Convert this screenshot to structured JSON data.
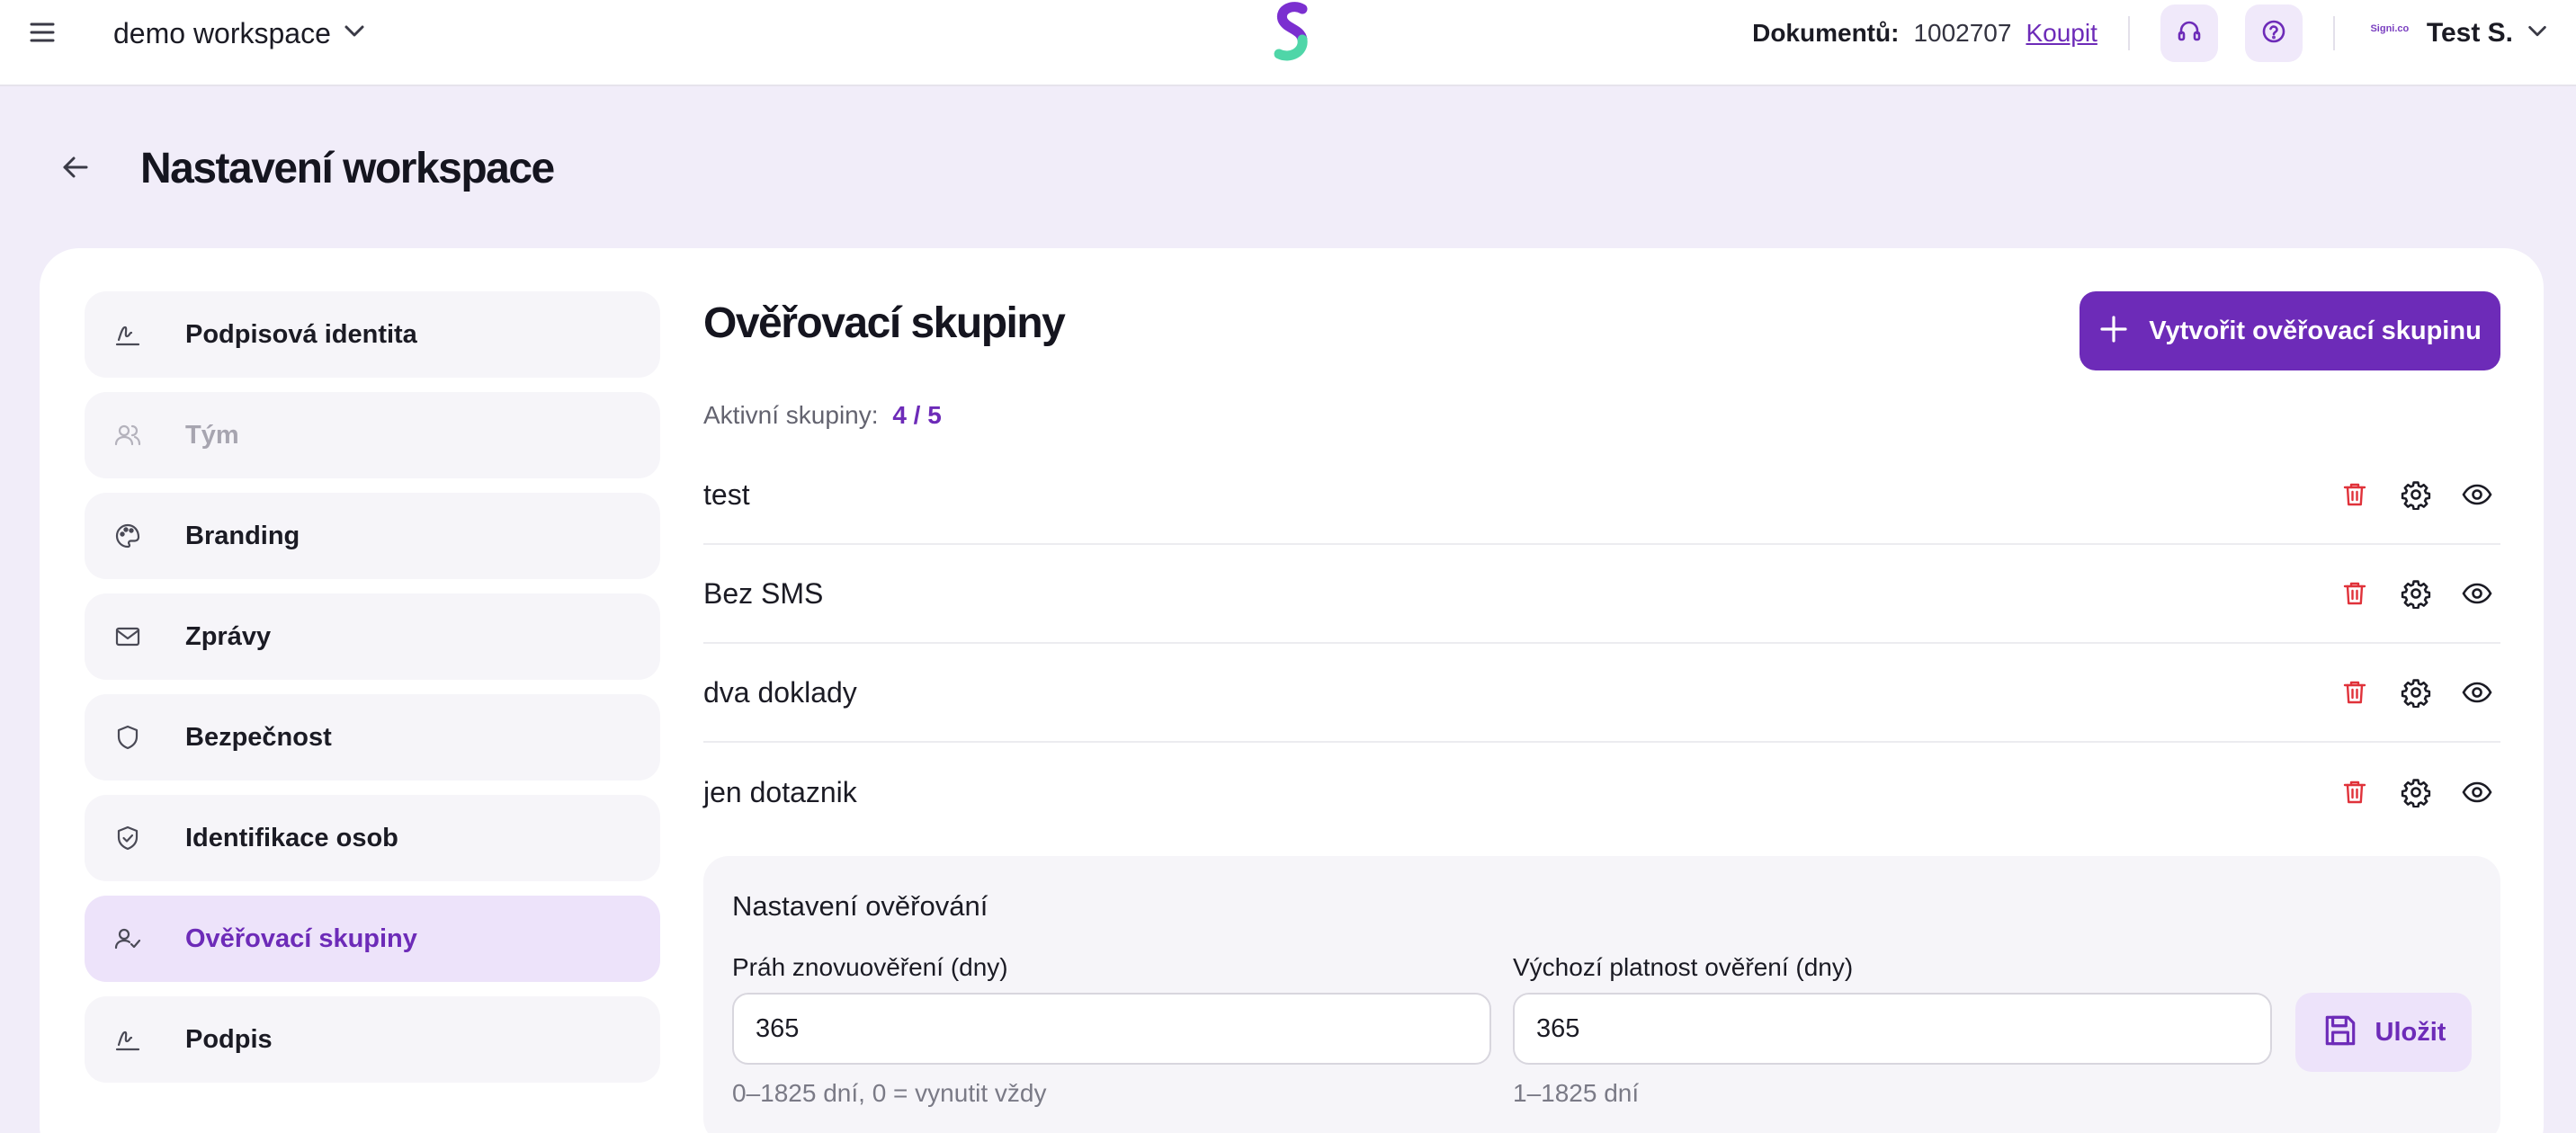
{
  "topbar": {
    "workspace_name": "demo workspace",
    "documents_label": "Dokumentů:",
    "documents_count": "1002707",
    "buy_label": "Koupit",
    "user_name": "Test S.",
    "user_logo_text": "Signi.co"
  },
  "page": {
    "title": "Nastavení workspace"
  },
  "sidebar": {
    "items": [
      {
        "label": "Podpisová identita",
        "icon": "signature-icon"
      },
      {
        "label": "Tým",
        "icon": "users-icon"
      },
      {
        "label": "Branding",
        "icon": "palette-icon"
      },
      {
        "label": "Zprávy",
        "icon": "mail-icon"
      },
      {
        "label": "Bezpečnost",
        "icon": "shield-icon"
      },
      {
        "label": "Identifikace osob",
        "icon": "shield-check-icon"
      },
      {
        "label": "Ověřovací skupiny",
        "icon": "user-check-icon"
      },
      {
        "label": "Podpis",
        "icon": "signature-icon"
      }
    ]
  },
  "content": {
    "title": "Ověřovací skupiny",
    "active_groups_label": "Aktivní skupiny:",
    "active_groups_value": "4 / 5",
    "create_button_label": "Vytvořit ověřovací skupinu",
    "groups": [
      {
        "name": "test"
      },
      {
        "name": "Bez SMS"
      },
      {
        "name": "dva doklady"
      },
      {
        "name": "jen dotaznik"
      }
    ]
  },
  "verification_settings": {
    "title": "Nastavení ověřování",
    "threshold_label": "Práh znovuověření (dny)",
    "threshold_value": "365",
    "threshold_hint": "0–1825 dní, 0 = vynutit vždy",
    "validity_label": "Výchozí platnost ověření (dny)",
    "validity_value": "365",
    "validity_hint": "1–1825 dní",
    "save_label": "Uložit"
  },
  "colors": {
    "accent": "#6d2bb8",
    "accent_light": "#ede3fa",
    "danger": "#e0323a",
    "page_bg": "#f1edf9"
  }
}
